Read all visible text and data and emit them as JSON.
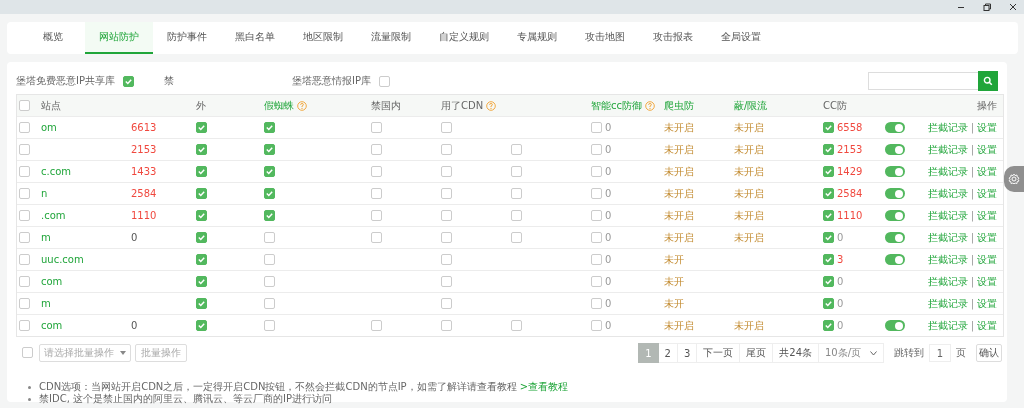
{
  "tabs": [
    {
      "label": "概览",
      "selected": false
    },
    {
      "label": "网站防护",
      "selected": true
    },
    {
      "label": "防护事件",
      "selected": false
    },
    {
      "label": "黑白名单",
      "selected": false
    },
    {
      "label": "地区限制",
      "selected": false
    },
    {
      "label": "流量限制",
      "selected": false
    },
    {
      "label": "自定义规则",
      "selected": false
    },
    {
      "label": "专属规则",
      "selected": false
    },
    {
      "label": "攻击地图",
      "selected": false
    },
    {
      "label": "攻击报表",
      "selected": false
    },
    {
      "label": "全局设置",
      "selected": false
    }
  ],
  "filters": [
    {
      "kind": "checkbox",
      "label": "堡塔免费恶意IP共享库",
      "checked": true
    },
    {
      "kind": "text",
      "label": "禁"
    },
    {
      "kind": "checkbox",
      "label": "堡塔恶意情报IP库",
      "checked": false
    }
  ],
  "table": {
    "columns": [
      {
        "kind": "select",
        "checked": false
      },
      {
        "kind": "text",
        "label": "站点"
      },
      {
        "kind": "blank"
      },
      {
        "kind": "text",
        "label": "外"
      },
      {
        "kind": "text",
        "label": "假蜘蛛",
        "help": true,
        "accent": true
      },
      {
        "kind": "text",
        "label": "禁国内"
      },
      {
        "kind": "text",
        "label": "用了CDN",
        "help": true
      },
      {
        "kind": "blank"
      },
      {
        "kind": "text",
        "label": "智能cc防御",
        "help": true,
        "accent": true
      },
      {
        "kind": "text",
        "label": "爬虫防",
        "accent": true
      },
      {
        "kind": "text",
        "label": "蔽/限流",
        "accent": true
      },
      {
        "kind": "text",
        "label": "CC防"
      },
      {
        "kind": "blank"
      },
      {
        "kind": "end",
        "label": "操作"
      }
    ],
    "rows": [
      {
        "selected": false,
        "site": "om",
        "count": "6613",
        "alert": true,
        "foreign": true,
        "fake_spider": true,
        "no_domestic": false,
        "cdn": false,
        "smart_cc": {
          "checked": false,
          "count": "0"
        },
        "crawler": "未开启",
        "limit": "未开启",
        "cc": {
          "checked": true,
          "count": "6558",
          "alert": true
        },
        "enabled": true,
        "actions": [
          "拦截记录",
          "|",
          "设置"
        ]
      },
      {
        "selected": false,
        "count": "2153",
        "alert": true,
        "foreign": true,
        "fake_spider": true,
        "no_domestic": false,
        "cdn": false,
        "column_8": false,
        "smart_cc": {
          "checked": false,
          "count": "0"
        },
        "crawler": "未开启",
        "limit": "未开启",
        "cc": {
          "checked": true,
          "count": "2153",
          "alert": true
        },
        "enabled": true,
        "actions": [
          "拦截记录",
          "|",
          "设置"
        ]
      },
      {
        "selected": false,
        "site": "c.com",
        "count": "1433",
        "alert": true,
        "foreign": true,
        "fake_spider": true,
        "no_domestic": false,
        "cdn": false,
        "column_8": false,
        "smart_cc": {
          "checked": false,
          "count": "0"
        },
        "crawler": "未开启",
        "limit": "未开启",
        "cc": {
          "checked": true,
          "count": "1429",
          "alert": true
        },
        "enabled": true,
        "actions": [
          "拦截记录",
          "|",
          "设置"
        ]
      },
      {
        "selected": false,
        "site": "n",
        "count": "2584",
        "alert": true,
        "foreign": true,
        "fake_spider": true,
        "no_domestic": false,
        "cdn": false,
        "column_8": false,
        "smart_cc": {
          "checked": false,
          "count": "0"
        },
        "crawler": "未开启",
        "limit": "未开启",
        "cc": {
          "checked": true,
          "count": "2584",
          "alert": true
        },
        "enabled": true,
        "actions": [
          "拦截记录",
          "|",
          "设置"
        ]
      },
      {
        "selected": false,
        "site": ".com",
        "count": "1110",
        "alert": true,
        "foreign": true,
        "fake_spider": true,
        "no_domestic": false,
        "cdn": false,
        "column_8": false,
        "smart_cc": {
          "checked": false,
          "count": "0"
        },
        "crawler": "未开启",
        "limit": "未开启",
        "cc": {
          "checked": true,
          "count": "1110",
          "alert": true
        },
        "enabled": true,
        "actions": [
          "拦截记录",
          "|",
          "设置"
        ]
      },
      {
        "selected": false,
        "site": "m",
        "count": "0",
        "alert": false,
        "foreign": true,
        "fake_spider": false,
        "no_domestic": false,
        "cdn": false,
        "column_8": false,
        "smart_cc": {
          "checked": false,
          "count": "0"
        },
        "crawler": "未开启",
        "limit": "未开启",
        "cc": {
          "checked": true,
          "count": "0",
          "alert": false
        },
        "enabled": true,
        "actions": [
          "拦截记录",
          "|",
          "设置"
        ]
      },
      {
        "selected": false,
        "site": "uuc.com",
        "foreign": true,
        "fake_spider": false,
        "cdn": false,
        "smart_cc": {
          "checked": false,
          "count": "0"
        },
        "crawler": "未开",
        "cc": {
          "checked": true,
          "count": "3",
          "alert": true
        },
        "enabled": true,
        "actions": [
          "拦截记录",
          "|",
          "设置"
        ]
      },
      {
        "selected": false,
        "site": "com",
        "foreign": true,
        "fake_spider": false,
        "cdn": false,
        "smart_cc": {
          "checked": false,
          "count": "0"
        },
        "crawler": "未开",
        "cc": {
          "checked": true,
          "count": "0",
          "alert": false
        },
        "actions": [
          "拦截记录",
          "|",
          "设置"
        ]
      },
      {
        "selected": false,
        "site": "m",
        "foreign": true,
        "fake_spider": false,
        "cdn": false,
        "smart_cc": {
          "checked": false,
          "count": "0"
        },
        "crawler": "未开",
        "cc": {
          "checked": true,
          "count": "0",
          "alert": false
        },
        "actions": [
          "拦截记录",
          "|",
          "设置"
        ]
      },
      {
        "selected": false,
        "site": "com",
        "count": "0",
        "alert": false,
        "foreign": true,
        "fake_spider": false,
        "no_domestic": false,
        "cdn": false,
        "column_8": false,
        "smart_cc": {
          "checked": false,
          "count": "0"
        },
        "crawler": "未开启",
        "limit": "未开启",
        "cc": {
          "checked": true,
          "count": "0",
          "alert": false
        },
        "enabled": true,
        "actions": [
          "拦截记录",
          "|",
          "设置"
        ]
      }
    ]
  },
  "batch": {
    "checked": false,
    "placeholder": "请选择批量操作",
    "button": "批量操作"
  },
  "pagination": {
    "pages": [
      {
        "label": "1",
        "selected": true
      },
      {
        "label": "2",
        "selected": false
      },
      {
        "label": "3",
        "selected": false
      }
    ],
    "next": "下一页",
    "last": "尾页",
    "total": "共24条",
    "page_size": "10条/页",
    "goto_label": "跳转到",
    "goto_value": "1",
    "page_unit": "页",
    "confirm": "确认"
  },
  "notes": [
    {
      "text": "CDN选项：当网站开启CDN之后，一定得开启CDN按钮，不然会拦截CDN的节点IP，如需了解详请查看教程",
      "link": ">查看教程"
    },
    {
      "text": "禁IDC, 这个是禁止国内的阿里云、腾讯云、等云厂商的IP进行访问"
    }
  ]
}
